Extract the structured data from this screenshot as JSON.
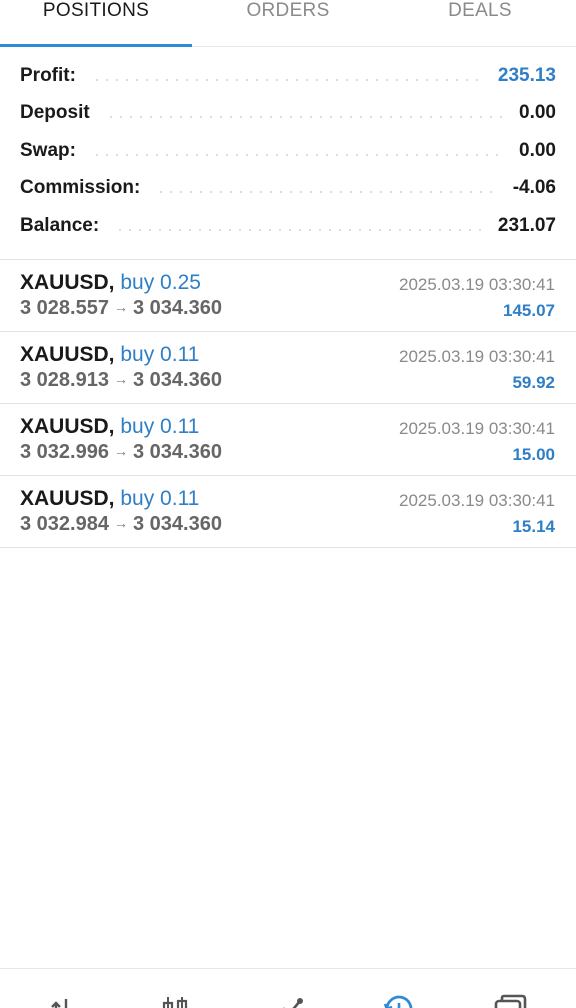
{
  "tabs": [
    {
      "label": "POSITIONS",
      "active": true
    },
    {
      "label": "ORDERS",
      "active": false
    },
    {
      "label": "DEALS",
      "active": false
    }
  ],
  "summary": {
    "profit_label": "Profit:",
    "profit_value": "235.13",
    "deposit_label": "Deposit",
    "deposit_value": "0.00",
    "swap_label": "Swap:",
    "swap_value": "0.00",
    "commission_label": "Commission:",
    "commission_value": "-4.06",
    "balance_label": "Balance:",
    "balance_value": "231.07"
  },
  "positions": [
    {
      "symbol": "XAUUSD,",
      "side": "buy 0.25",
      "open_price": "3 028.557",
      "arrow": "→",
      "current_price": "3 034.360",
      "time": "2025.03.19 03:30:41",
      "profit": "145.07"
    },
    {
      "symbol": "XAUUSD,",
      "side": "buy 0.11",
      "open_price": "3 028.913",
      "arrow": "→",
      "current_price": "3 034.360",
      "time": "2025.03.19 03:30:41",
      "profit": "59.92"
    },
    {
      "symbol": "XAUUSD,",
      "side": "buy 0.11",
      "open_price": "3 032.996",
      "arrow": "→",
      "current_price": "3 034.360",
      "time": "2025.03.19 03:30:41",
      "profit": "15.00"
    },
    {
      "symbol": "XAUUSD,",
      "side": "buy 0.11",
      "open_price": "3 032.984",
      "arrow": "→",
      "current_price": "3 034.360",
      "time": "2025.03.19 03:30:41",
      "profit": "15.14"
    }
  ],
  "bottom_nav": [
    {
      "icon": "quotes-icon",
      "active": false
    },
    {
      "icon": "chart-icon",
      "active": false
    },
    {
      "icon": "trade-icon",
      "active": false
    },
    {
      "icon": "history-icon",
      "active": true
    },
    {
      "icon": "messages-icon",
      "active": false
    }
  ],
  "colors": {
    "accent": "#2f8bd6",
    "profit_blue": "#2f7fc6",
    "text": "#1a1a1a",
    "muted": "#8a8a8a"
  }
}
